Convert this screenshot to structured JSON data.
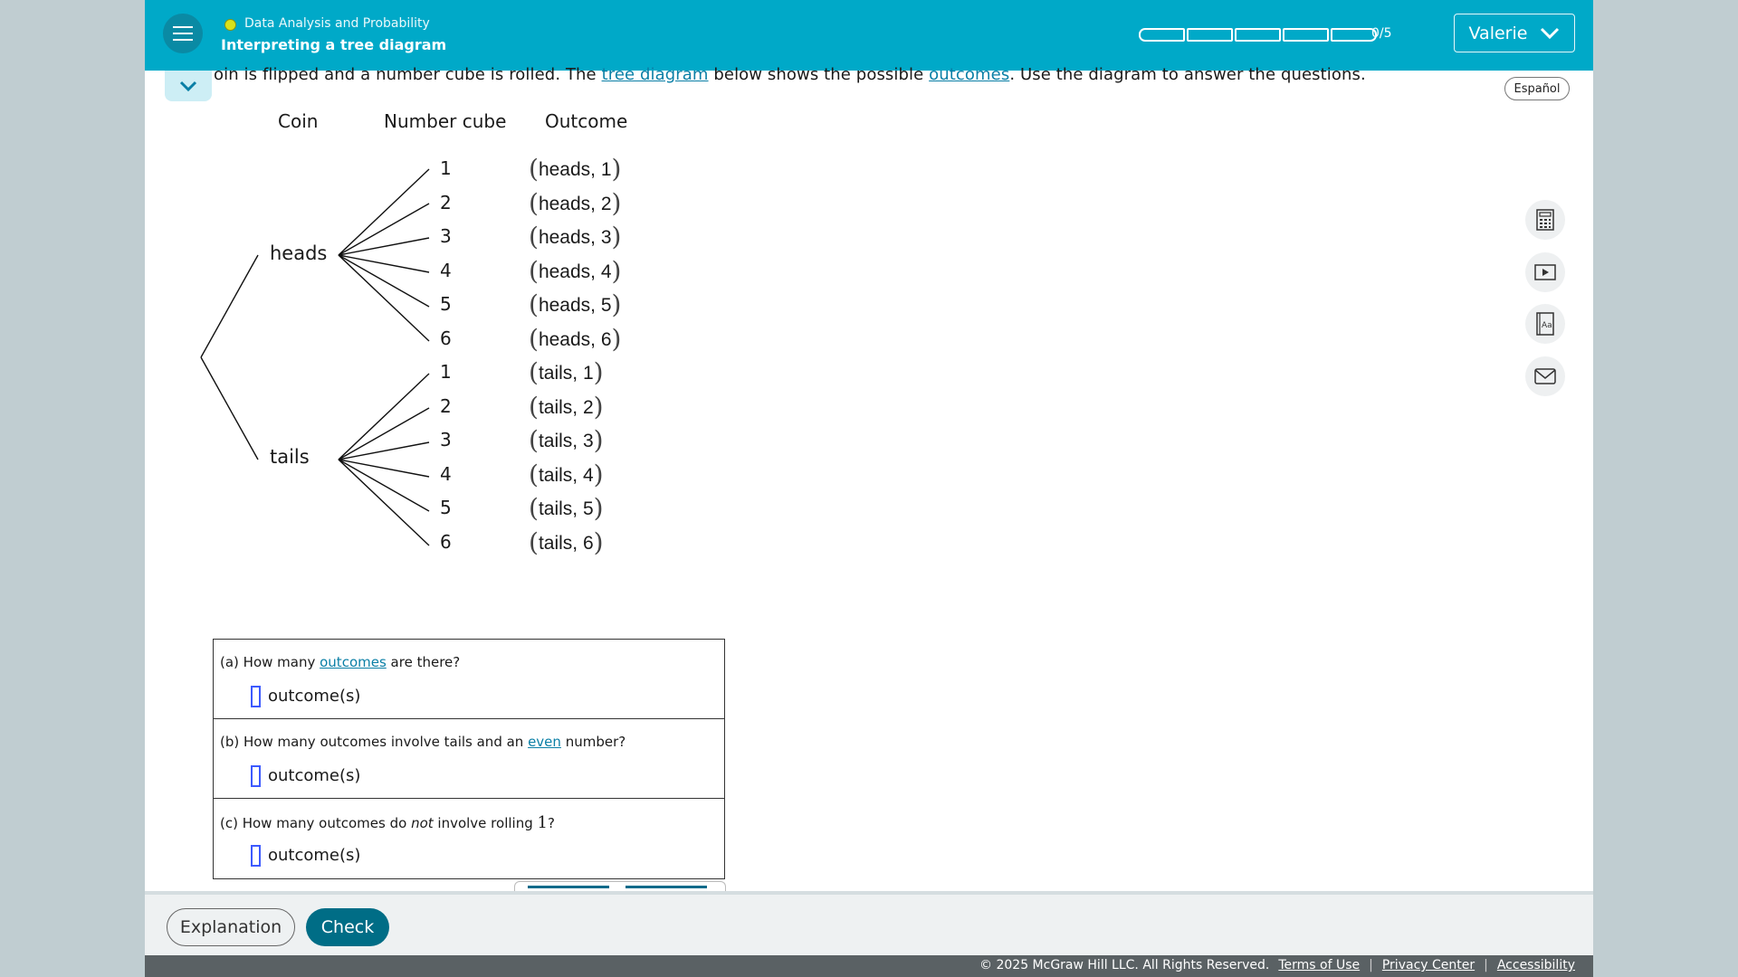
{
  "header": {
    "topic": "Data Analysis and Probability",
    "lesson": "Interpreting a tree diagram",
    "progress_text": "0/5",
    "progress_fraction": 0,
    "user_name": "Valerie"
  },
  "espanol_label": "Español",
  "question": {
    "part1": "oin is flipped and a number cube is rolled. The ",
    "link1": "tree diagram",
    "part2": " below shows the possible ",
    "link2": "outcomes",
    "part3": ". Use the diagram to answer the questions."
  },
  "diagram": {
    "col_coin": "Coin",
    "col_cube": "Number cube",
    "col_outcome": "Outcome",
    "heads": "heads",
    "tails": "tails",
    "heads_numbers": [
      "1",
      "2",
      "3",
      "4",
      "5",
      "6"
    ],
    "tails_numbers": [
      "1",
      "2",
      "3",
      "4",
      "5",
      "6"
    ],
    "heads_outcomes": [
      "heads, 1",
      "heads, 2",
      "heads, 3",
      "heads, 4",
      "heads, 5",
      "heads, 6"
    ],
    "tails_outcomes": [
      "tails, 1",
      "tails, 2",
      "tails, 3",
      "tails, 4",
      "tails, 5",
      "tails, 6"
    ]
  },
  "answers": {
    "a": {
      "prefix": "(a) How many ",
      "link": "outcomes",
      "suffix": " are there?",
      "unit": "outcome(s)",
      "value": ""
    },
    "b": {
      "prefix": "(b) How many outcomes involve tails and an ",
      "link": "even",
      "suffix": " number?",
      "unit": "outcome(s)",
      "value": ""
    },
    "c": {
      "prefix": "(c) How many outcomes do ",
      "em": "not",
      "mid": " involve rolling ",
      "num": "1",
      "suffix": "?",
      "unit": "outcome(s)",
      "value": ""
    }
  },
  "footer": {
    "explanation": "Explanation",
    "check": "Check",
    "copyright": "© 2025 McGraw Hill LLC. All Rights Reserved.",
    "terms": "Terms of Use",
    "privacy": "Privacy Center",
    "accessibility": "Accessibility",
    "separator": "|"
  },
  "tools": [
    "calculator-icon",
    "video-icon",
    "glossary-icon",
    "message-icon"
  ],
  "colors": {
    "header": "#00a9c8",
    "accent": "#006d86",
    "link": "#0a7fa6",
    "input_border": "#3d5afe"
  }
}
